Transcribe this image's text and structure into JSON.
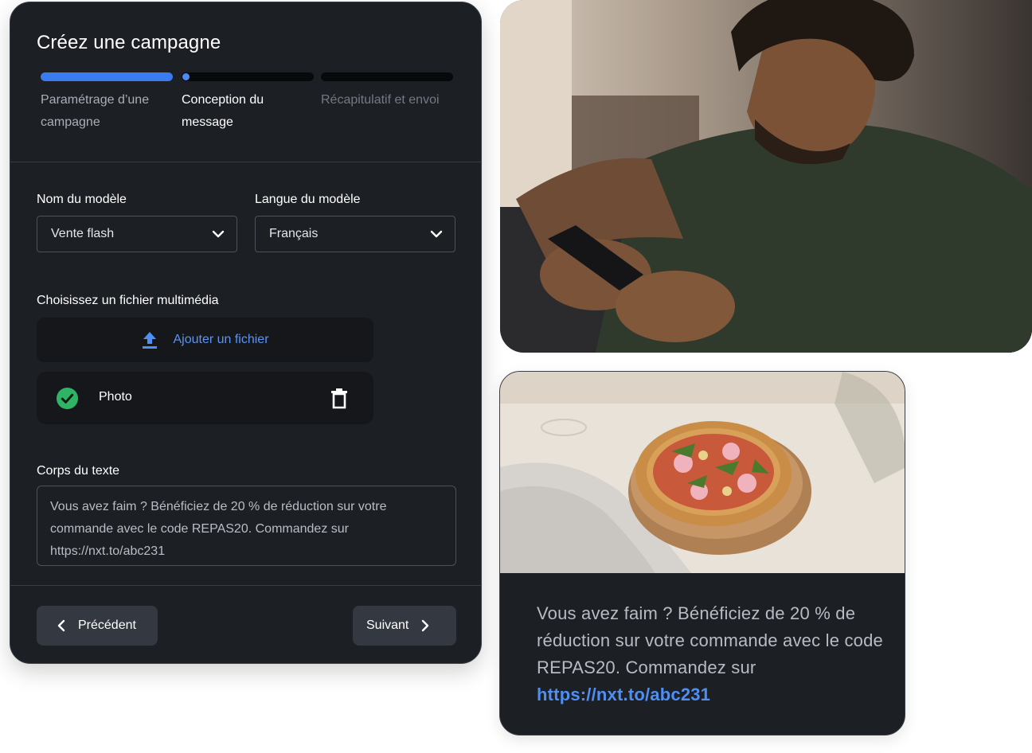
{
  "panel": {
    "title": "Créez une campagne",
    "steps": [
      {
        "label": "Paramétrage d’une campagne",
        "state": "completed",
        "progress": 1.0
      },
      {
        "label": "Conception du message",
        "state": "current",
        "progress": 0.05
      },
      {
        "label": "Récapitulatif et envoi",
        "state": "upcoming",
        "progress": 0
      }
    ],
    "template_name": {
      "label": "Nom du modèle",
      "value": "Vente flash"
    },
    "template_language": {
      "label": "Langue du modèle",
      "value": "Français"
    },
    "media": {
      "label": "Choisissez un fichier multimédia",
      "upload_label": "Ajouter un fichier",
      "file_name": "Photo"
    },
    "body": {
      "label": "Corps du texte",
      "value": "Vous avez faim ? Bénéficiez de 20 % de réduction sur votre commande avec le code REPAS20. Commandez sur https://nxt.to/abc231"
    },
    "prev_label": "Précédent",
    "next_label": "Suivant"
  },
  "preview": {
    "message_text": "Vous avez faim ? Bénéficiez de 20 % de réduction sur votre commande avec le code REPAS20. Commandez sur ",
    "message_link": "https://nxt.to/abc231"
  },
  "colors": {
    "panel_bg": "#1c1f24",
    "accent": "#3a7bf0",
    "link": "#4f8ff3",
    "success": "#2fb466"
  },
  "icons": [
    "chevron-down-icon",
    "upload-icon",
    "check-circle-icon",
    "trash-icon",
    "chevron-left-icon",
    "chevron-right-icon"
  ]
}
